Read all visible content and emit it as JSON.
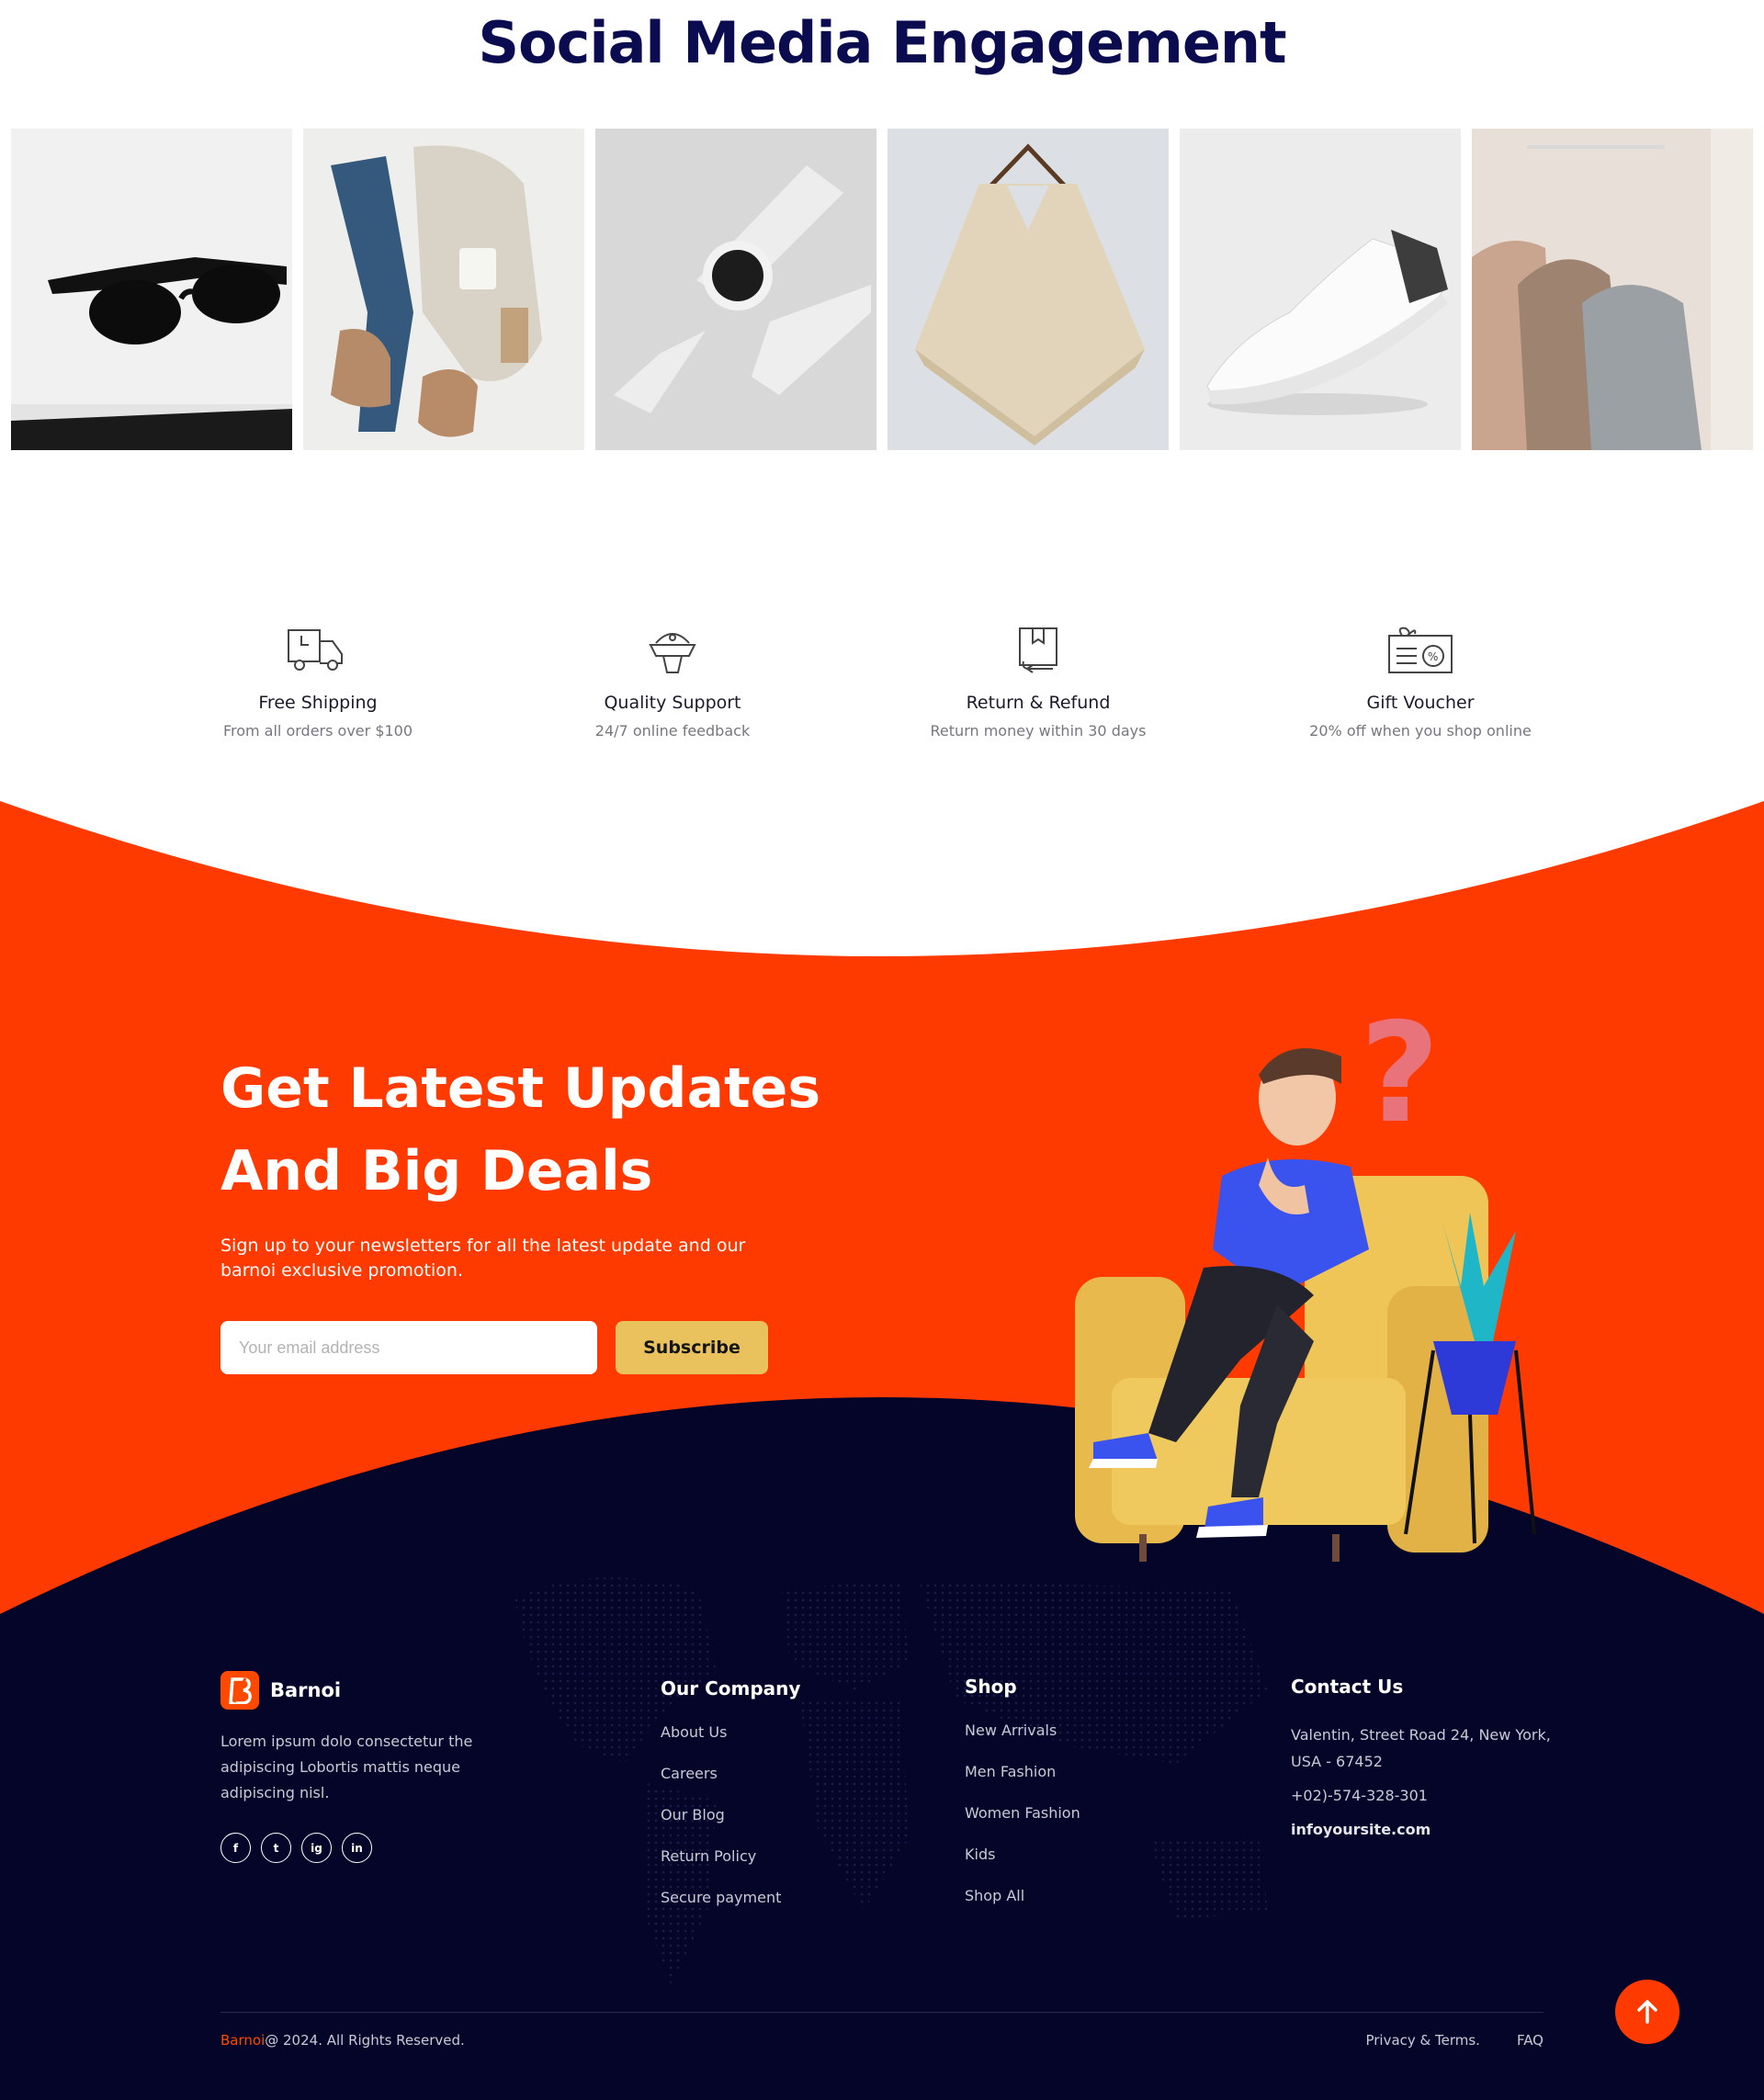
{
  "social": {
    "title": "Social Media Engagement",
    "gallery": [
      {
        "icon": "sunglasses-photo"
      },
      {
        "icon": "outfit-flatlay-photo"
      },
      {
        "icon": "smartwatch-photo"
      },
      {
        "icon": "knit-poncho-photo"
      },
      {
        "icon": "sneaker-photo"
      },
      {
        "icon": "clothing-rack-photo"
      }
    ]
  },
  "features": [
    {
      "title": "Free Shipping",
      "subtitle": "From all orders over $100",
      "icon": "truck-icon"
    },
    {
      "title": "Quality Support",
      "subtitle": "24/7 online feedback",
      "icon": "support-icon"
    },
    {
      "title": "Return & Refund",
      "subtitle": "Return money within 30 days",
      "icon": "return-box-icon"
    },
    {
      "title": "Gift Voucher",
      "subtitle": "20% off when you shop online",
      "icon": "voucher-icon"
    }
  ],
  "newsletter": {
    "title_line1": "Get Latest Updates",
    "title_line2": "And Big Deals",
    "description": "Sign up to your newsletters for all the latest update and our barnoi exclusive promotion.",
    "email_placeholder": "Your email address",
    "subscribe_label": "Subscribe"
  },
  "footer": {
    "brand": "Barnoi",
    "description": "Lorem ipsum dolo consectetur the adipiscing Lobortis mattis neque adipiscing nisl.",
    "socials": [
      {
        "label": "f",
        "icon": "facebook-icon"
      },
      {
        "label": "t",
        "icon": "twitter-icon"
      },
      {
        "label": "ig",
        "icon": "instagram-icon"
      },
      {
        "label": "in",
        "icon": "linkedin-icon"
      }
    ],
    "company": {
      "heading": "Our Company",
      "links": [
        "About Us",
        "Careers",
        "Our Blog",
        "Return Policy",
        "Secure payment"
      ]
    },
    "shop": {
      "heading": "Shop",
      "links": [
        "New Arrivals",
        "Men Fashion",
        "Women Fashion",
        "Kids",
        "Shop All"
      ]
    },
    "contact": {
      "heading": "Contact Us",
      "address": "Valentin, Street Road 24, New York, USA - 67452",
      "phone": "+02)-574-328-301",
      "email": "infoyoursite.com"
    },
    "copyright_brand": "Barnoi",
    "copyright_rest": "@ 2024. All Rights Reserved.",
    "bottom_links": [
      "Privacy & Terms.",
      "FAQ"
    ]
  },
  "colors": {
    "orange": "#ff3a00",
    "navy": "#05052a",
    "title_navy": "#0b0b4f",
    "button_yellow": "#e9c25e"
  }
}
